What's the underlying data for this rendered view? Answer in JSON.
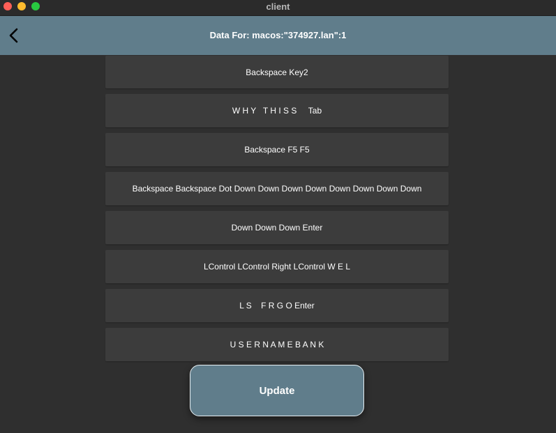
{
  "window": {
    "title": "client"
  },
  "header": {
    "title": "Data For: macos:\"374927.lan\":1"
  },
  "items": [
    "Backspace Key2",
    "W H Y   T H I S S     Tab",
    "Backspace F5 F5",
    "Backspace Backspace Dot Down Down Down Down Down Down Down Down",
    "Down Down Down Enter",
    "LControl LControl Right LControl W E L",
    "L S    F R G O Enter",
    "U S E R N A M E B A N K"
  ],
  "update_button": {
    "label": "Update"
  },
  "colors": {
    "header": "#607d8b",
    "background": "#2f2f2f",
    "row": "#3c3c3c"
  }
}
